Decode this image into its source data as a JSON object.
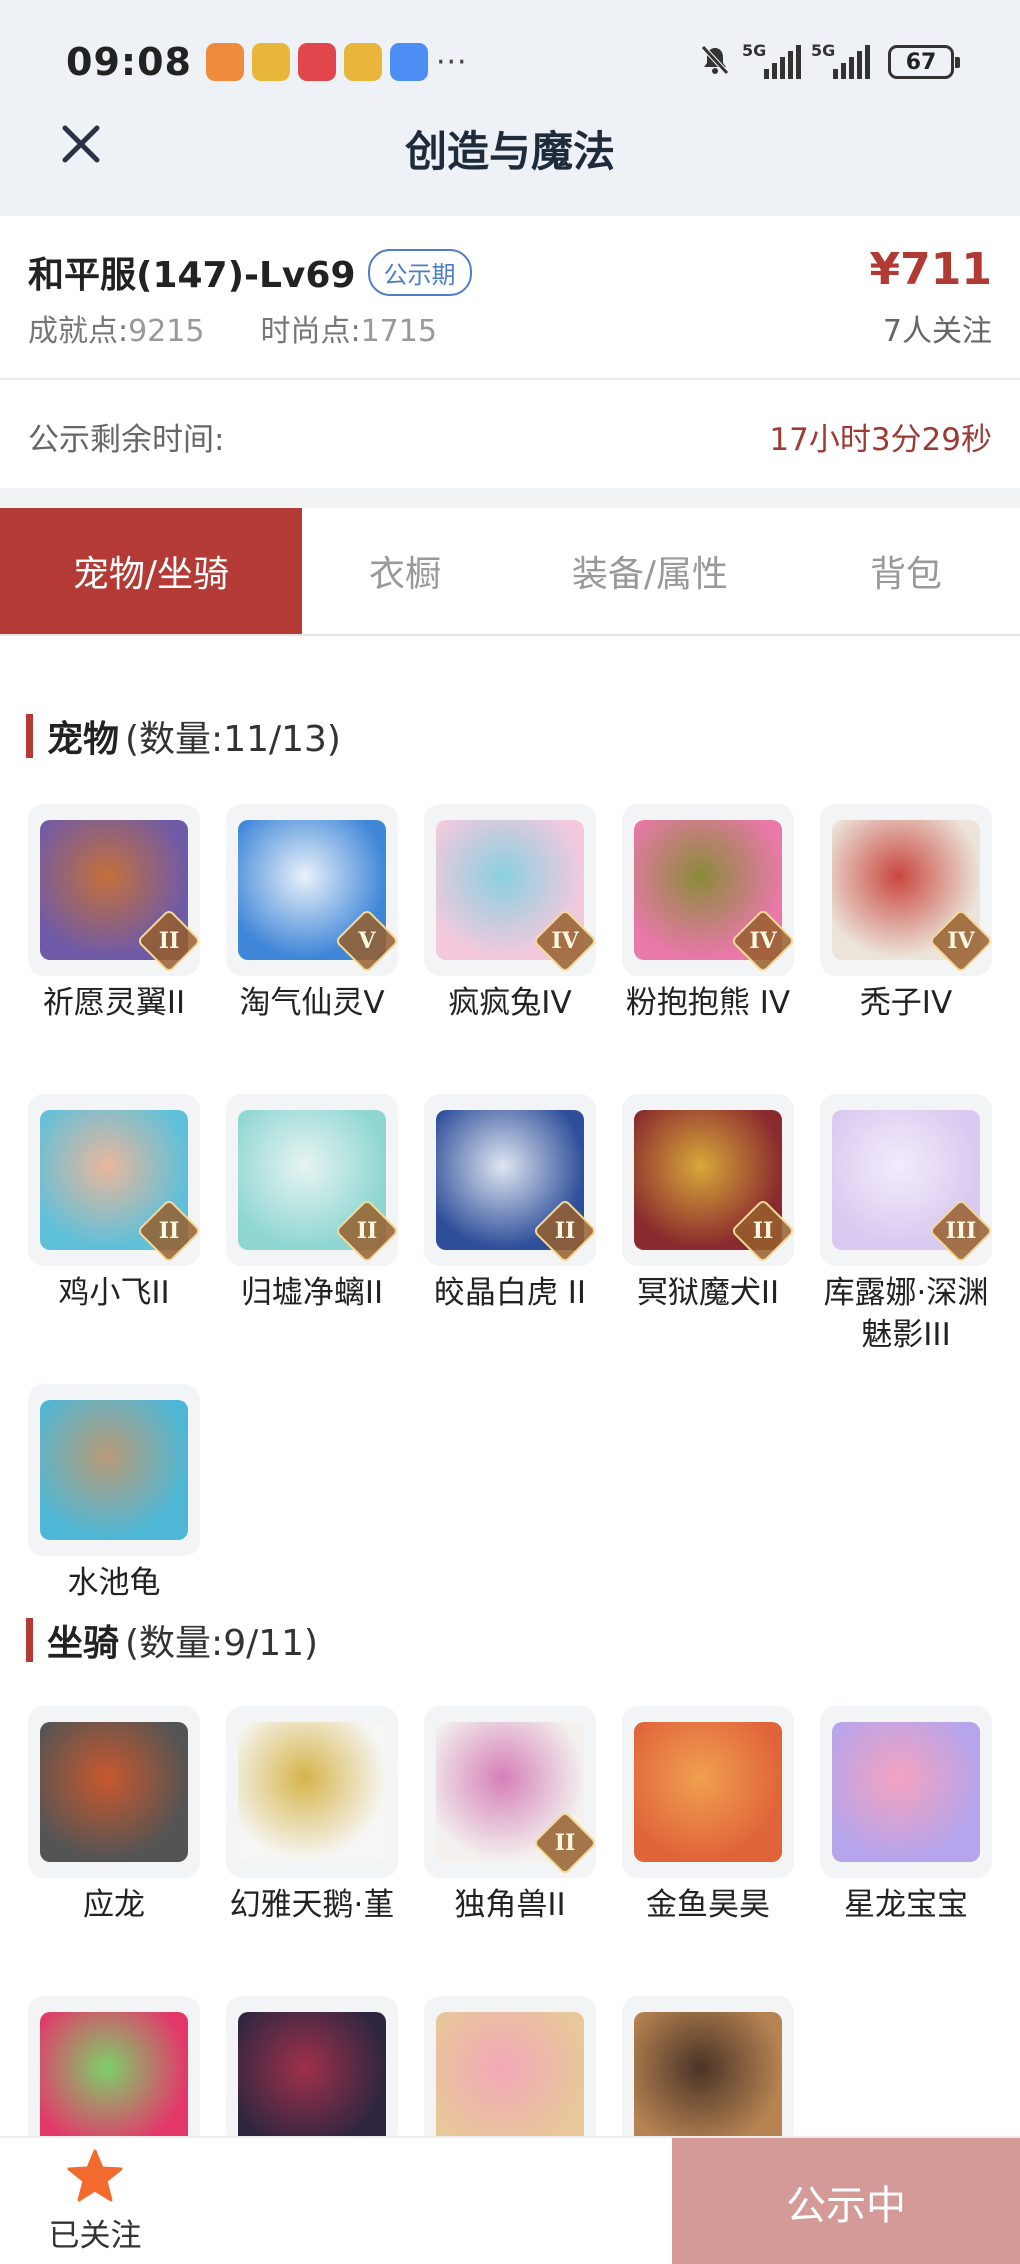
{
  "status_bar": {
    "time": "09:08",
    "notification_icons": [
      {
        "icon": "heart-app-icon",
        "color": "#f08a3c"
      },
      {
        "icon": "weibo-icon",
        "color": "#e8b63a"
      },
      {
        "icon": "618-app-icon",
        "color": "#e0464b"
      },
      {
        "icon": "weibo-icon",
        "color": "#e8b63a"
      },
      {
        "icon": "message-icon",
        "color": "#4d8ef5"
      }
    ],
    "more": "···",
    "signal_1": "5G",
    "signal_2": "5G",
    "battery": "67"
  },
  "header": {
    "title": "创造与魔法"
  },
  "account": {
    "name": "和平服(147)-Lv69",
    "badge": "公示期",
    "achievement_label": "成就点:",
    "achievement_value": "9215",
    "fashion_label": "时尚点:",
    "fashion_value": "1715",
    "price": "¥711",
    "watchers": "7人关注"
  },
  "timer": {
    "label": "公示剩余时间:",
    "value": "17小时3分29秒"
  },
  "tabs": [
    {
      "label": "宠物/坐骑",
      "active": true
    },
    {
      "label": "衣橱",
      "active": false
    },
    {
      "label": "装备/属性",
      "active": false
    },
    {
      "label": "背包",
      "active": false
    }
  ],
  "pets": {
    "title": "宠物",
    "count": "(数量:11/13)",
    "items": [
      {
        "name": "祈愿灵翼II",
        "tier": "II",
        "colors": [
          "#6f5aa8",
          "#c4703a"
        ]
      },
      {
        "name": "淘气仙灵V",
        "tier": "V",
        "colors": [
          "#3f86d8",
          "#e9f1fb"
        ]
      },
      {
        "name": "疯疯兔IV",
        "tier": "IV",
        "colors": [
          "#f4c9dd",
          "#8ad0e0"
        ]
      },
      {
        "name": "粉抱抱熊 IV",
        "tier": "IV",
        "colors": [
          "#e879a8",
          "#8b8a3a"
        ]
      },
      {
        "name": "秃子IV",
        "tier": "IV",
        "colors": [
          "#ece4da",
          "#c9473e"
        ]
      },
      {
        "name": "鸡小飞II",
        "tier": "II",
        "colors": [
          "#5fc0da",
          "#e9b79c"
        ]
      },
      {
        "name": "归墟净螭II",
        "tier": "II",
        "colors": [
          "#8fd6d2",
          "#e6f4f2"
        ]
      },
      {
        "name": "皎晶白虎 II",
        "tier": "II",
        "colors": [
          "#2f4f9a",
          "#dfe6f2"
        ]
      },
      {
        "name": "冥狱魔犬II",
        "tier": "II",
        "colors": [
          "#8a2a2e",
          "#d8a83a"
        ]
      },
      {
        "name": "库露娜·深渊魅影III",
        "tier": "III",
        "colors": [
          "#d9c8f0",
          "#f3ecfb"
        ]
      },
      {
        "name": "水池龟",
        "tier": "",
        "colors": [
          "#4fb7d6",
          "#b89a76"
        ]
      }
    ]
  },
  "mounts": {
    "title": "坐骑",
    "count": "(数量:9/11)",
    "items": [
      {
        "name": "应龙",
        "tier": "",
        "colors": [
          "#545454",
          "#c8582e"
        ]
      },
      {
        "name": "幻雅天鹅·堇",
        "tier": "",
        "colors": [
          "#f6f6f4",
          "#d6b44a"
        ]
      },
      {
        "name": "独角兽II",
        "tier": "II",
        "colors": [
          "#f3f0ee",
          "#d57fb8"
        ]
      },
      {
        "name": "金鱼昊昊",
        "tier": "",
        "colors": [
          "#e0643a",
          "#f0a050"
        ]
      },
      {
        "name": "星龙宝宝",
        "tier": "",
        "colors": [
          "#b6a5ec",
          "#f3a2c0"
        ]
      },
      {
        "name": "",
        "tier": "",
        "colors": [
          "#e3386a",
          "#7ecf6a"
        ]
      },
      {
        "name": "",
        "tier": "",
        "colors": [
          "#2e2640",
          "#a0304a"
        ]
      },
      {
        "name": "",
        "tier": "",
        "colors": [
          "#e8c79a",
          "#f2a8b8"
        ]
      },
      {
        "name": "",
        "tier": "",
        "colors": [
          "#b78352",
          "#4a3426"
        ]
      }
    ]
  },
  "bottom_bar": {
    "follow_label": "已关注",
    "status_button": "公示中"
  }
}
